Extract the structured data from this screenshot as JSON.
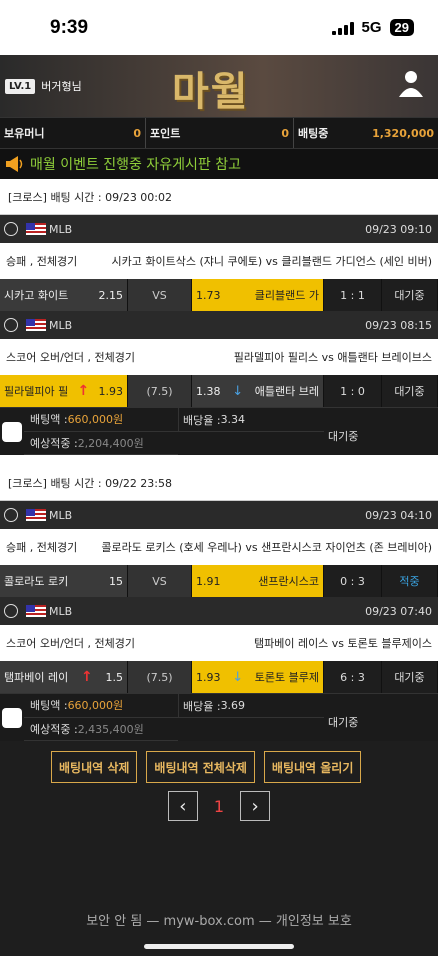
{
  "status": {
    "time": "9:39",
    "network": "5G",
    "battery": "29"
  },
  "header": {
    "level": "LV.1",
    "user": "버거형님",
    "logo": "마월"
  },
  "balance": {
    "money_label": "보유머니",
    "money": "0",
    "point_label": "포인트",
    "point": "0",
    "betting_label": "배팅중",
    "betting": "1,320,000"
  },
  "notice": "매월 이벤트 진행중 자유게시판 참고",
  "slips": [
    {
      "title": "[크로스] 배팅 시간 : 09/23 00:02",
      "games": [
        {
          "league": "MLB",
          "datetime": "09/23 09:10",
          "type": "승패 , 전체경기",
          "matchup": "시카고 화이트삭스 (쟈니 쿠에토)  vs  클리블랜드 가디언스 (세인 비버)",
          "home": "시카고 화이트",
          "home_odds": "2.15",
          "mid": "VS",
          "away_odds": "1.73",
          "away": "클리블랜드 가",
          "score": "1 : 1",
          "result": "대기중"
        },
        {
          "league": "MLB",
          "datetime": "09/23 08:15",
          "type": "스코어 오버/언더 , 전체경기",
          "matchup": "필라델피아 필리스  vs  애틀랜타 브레이브스",
          "home": "필라델피아 필",
          "home_odds": "1.93",
          "mid": "(7.5)",
          "away_odds": "1.38",
          "away": "애틀랜타 브레",
          "score": "1 : 0",
          "result": "대기중"
        }
      ],
      "bet_label": "배팅액 : ",
      "bet_amount": "660,000원",
      "rate_label": "배당율 : ",
      "rate": "3.34",
      "expect_label": "예상적중 : ",
      "expect": "2,204,400원",
      "state": "대기중"
    },
    {
      "title": "[크로스] 배팅 시간 : 09/22 23:58",
      "games": [
        {
          "league": "MLB",
          "datetime": "09/23 04:10",
          "type": "승패 , 전체경기",
          "matchup": "콜로라도 로키스 (호세 우레나)  vs  샌프란시스코 자이언츠 (존 브레비아)",
          "home": "콜로라도 로키",
          "home_odds": "15",
          "mid": "VS",
          "away_odds": "1.91",
          "away": "샌프란시스코",
          "score": "0 : 3",
          "result": "적중"
        },
        {
          "league": "MLB",
          "datetime": "09/23 07:40",
          "type": "스코어 오버/언더 , 전체경기",
          "matchup": "탬파베이 레이스  vs  토론토 블루제이스",
          "home": "탬파베이 레이",
          "home_odds": "1.5",
          "mid": "(7.5)",
          "away_odds": "1.93",
          "away": "토론토 블루제",
          "score": "6 : 3",
          "result": "대기중"
        }
      ],
      "bet_label": "배팅액 : ",
      "bet_amount": "660,000원",
      "rate_label": "배당율 : ",
      "rate": "3.69",
      "expect_label": "예상적중 : ",
      "expect": "2,435,400원",
      "state": "대기중"
    }
  ],
  "actions": {
    "delete": "배팅내역 삭제",
    "delete_all": "배팅내역 전체삭제",
    "post": "배팅내역 올리기"
  },
  "pager": {
    "prev": "‹",
    "page": "1",
    "next": "›"
  },
  "footer": "보안 안 됨 — myw-box.com — 개인정보 보호"
}
